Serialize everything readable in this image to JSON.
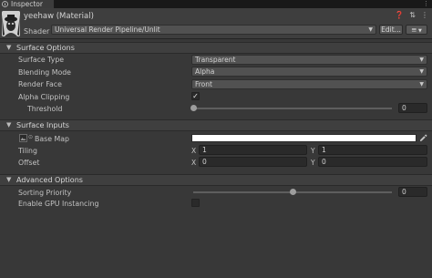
{
  "tab": {
    "label": "Inspector",
    "menu_icon": "kebab-menu-icon"
  },
  "material": {
    "title": "yeehaw (Material)",
    "shader_label": "Shader",
    "shader_value": "Universal Render Pipeline/Unlit",
    "edit_label": "Edit...",
    "list_icon": "≡"
  },
  "sections": {
    "surface_options": {
      "title": "Surface Options",
      "surface_type": {
        "label": "Surface Type",
        "value": "Transparent"
      },
      "blending_mode": {
        "label": "Blending Mode",
        "value": "Alpha"
      },
      "render_face": {
        "label": "Render Face",
        "value": "Front"
      },
      "alpha_clipping": {
        "label": "Alpha Clipping",
        "checked": true,
        "mark": "✓"
      },
      "threshold": {
        "label": "Threshold",
        "value": "0",
        "level": 0
      }
    },
    "surface_inputs": {
      "title": "Surface Inputs",
      "base_map": {
        "label": "Base Map",
        "color": "#FFFFFF"
      },
      "tiling": {
        "label": "Tiling",
        "x_label": "X",
        "x": "1",
        "y_label": "Y",
        "y": "1"
      },
      "offset": {
        "label": "Offset",
        "x_label": "X",
        "x": "0",
        "y_label": "Y",
        "y": "0"
      }
    },
    "advanced_options": {
      "title": "Advanced Options",
      "sorting_priority": {
        "label": "Sorting Priority",
        "value": "0",
        "level": 0.5
      },
      "gpu_instancing": {
        "label": "Enable GPU Instancing",
        "checked": false
      }
    }
  },
  "colors": {
    "background": "#383838",
    "section_header": "#3F3F3F",
    "field": "#2A2A2A",
    "dropdown": "#515151"
  }
}
